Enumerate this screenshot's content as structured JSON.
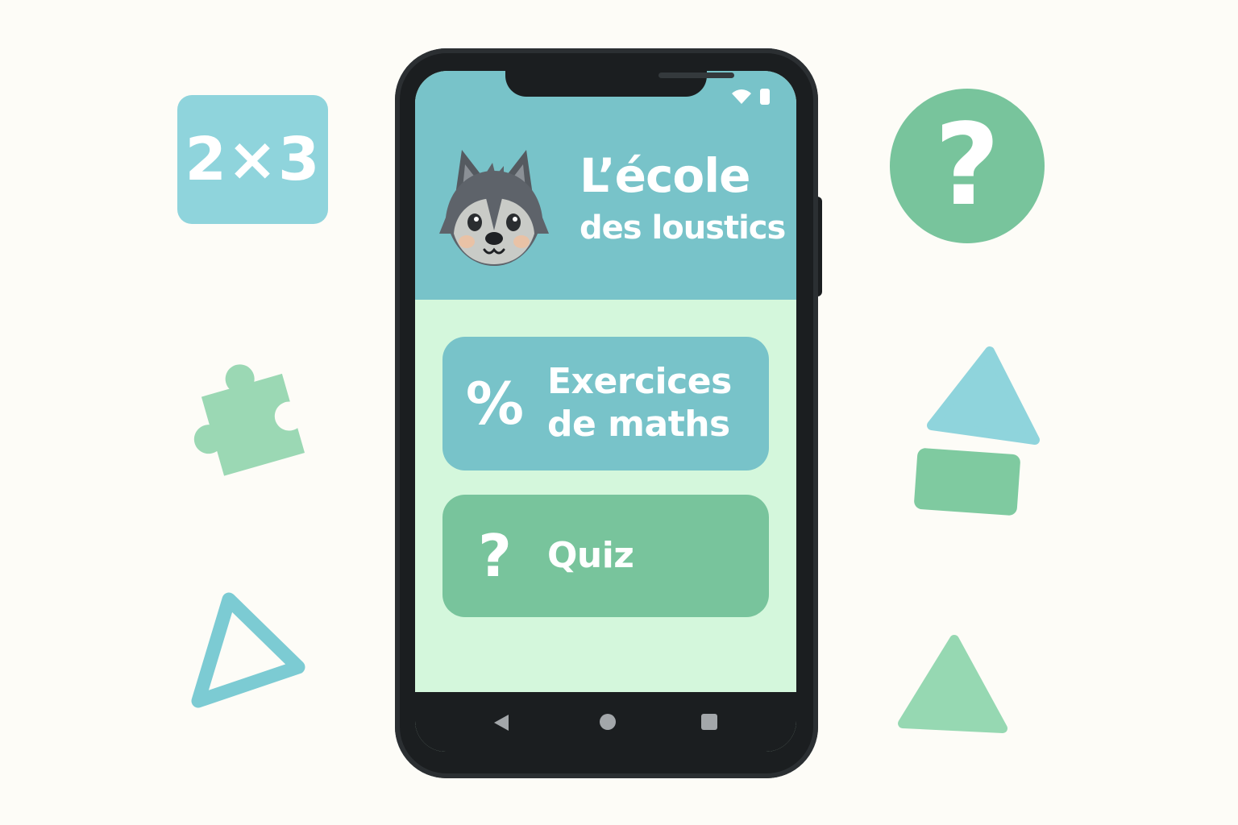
{
  "decorations": {
    "tile_text": "2×3",
    "circle_glyph": "?",
    "colors": {
      "teal": "#78c3c9",
      "light_teal": "#8fd4dc",
      "green": "#78c49c",
      "light_green": "#9bd8b4"
    }
  },
  "status_bar": {
    "icons": [
      "wifi-icon",
      "battery-icon"
    ]
  },
  "header": {
    "title_line1": "L’école",
    "title_line2": "des loustics",
    "mascot": "wolf-mascot-icon"
  },
  "menu": {
    "math": {
      "icon": "%",
      "label_line1": "Exercices",
      "label_line2": "de maths"
    },
    "quiz": {
      "icon": "?",
      "label": "Quiz"
    }
  },
  "navigation": {
    "items": [
      "back-icon",
      "home-icon",
      "recent-apps-icon"
    ]
  },
  "colors": {
    "header_bg": "#78c3c9",
    "screen_bg": "#d4f7dc",
    "phone_body": "#1b1e20"
  }
}
